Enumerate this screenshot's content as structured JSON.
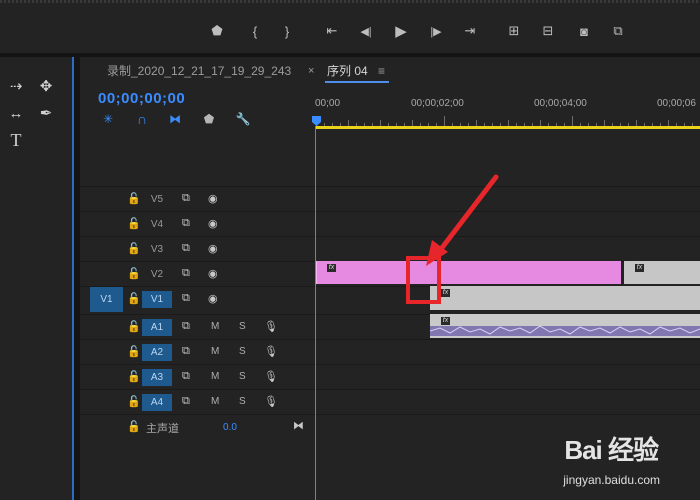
{
  "transport": {
    "buttons": [
      {
        "name": "add-marker-button",
        "glyph": "⬟"
      },
      {
        "name": "mark-in-button",
        "glyph": "{"
      },
      {
        "name": "mark-out-button",
        "glyph": "}"
      },
      {
        "name": "go-to-in-button",
        "glyph": "⇤"
      },
      {
        "name": "step-back-button",
        "glyph": "◀|"
      },
      {
        "name": "play-button",
        "glyph": "▶"
      },
      {
        "name": "step-forward-button",
        "glyph": "|▶"
      },
      {
        "name": "go-to-out-button",
        "glyph": "⇥"
      },
      {
        "name": "lift-button",
        "glyph": "⊞"
      },
      {
        "name": "extract-button",
        "glyph": "⊟"
      },
      {
        "name": "export-frame-button",
        "glyph": "◙"
      },
      {
        "name": "compare-view-button",
        "glyph": "⧉"
      }
    ]
  },
  "tools": {
    "items": [
      {
        "name": "track-select-tool-icon",
        "glyph": "⇢"
      },
      {
        "name": "ripple-edit-tool-icon",
        "glyph": "✥"
      },
      {
        "name": "slip-tool-icon",
        "glyph": "↔"
      },
      {
        "name": "pen-tool-icon",
        "glyph": "✒"
      },
      {
        "name": "type-tool-icon",
        "glyph": "T"
      }
    ]
  },
  "timeline": {
    "tabs": [
      {
        "label": "录制_2020_12_21_17_19_29_243"
      },
      {
        "label": "序列 04"
      }
    ],
    "close_glyph": "×",
    "menu_glyph": "≡",
    "timecode": "00;00;00;00",
    "ruler": [
      "00;00",
      "00;00;02;00",
      "00;00;04;00",
      "00;00;06"
    ],
    "tracks_video": [
      "V5",
      "V4",
      "V3",
      "V2",
      "V1"
    ],
    "source_video": "V1",
    "tracks_audio": [
      "A1",
      "A2",
      "A3",
      "A4"
    ],
    "audio_buttons": {
      "mute": "M",
      "solo": "S"
    },
    "master": {
      "label": "主声道",
      "value": "0.0"
    },
    "clip_fx": "fx"
  },
  "colors": {
    "accent": "#3a8cff",
    "clip_pink": "#e58ae0",
    "clip_gray": "#c6c6c6",
    "annotation_red": "#e6262b",
    "track_blue": "#1e5a8e",
    "work_area": "#e8d21a"
  },
  "watermark": {
    "brand": "Bai 经验",
    "url": "jingyan.baidu.com"
  }
}
